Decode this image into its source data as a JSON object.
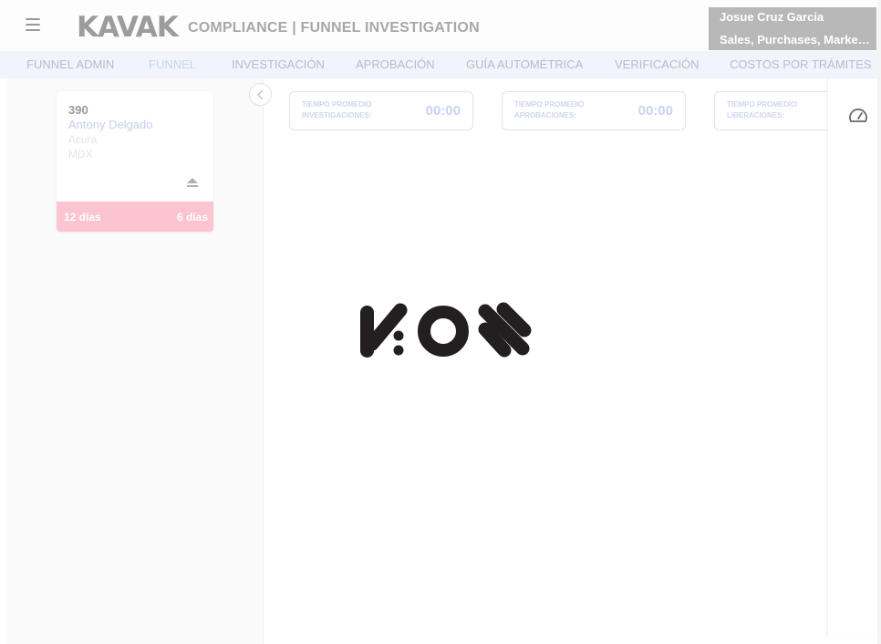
{
  "header": {
    "menu_icon": "hamburger-menu-icon",
    "logo": "KAVAK",
    "title": "COMPLIANCE | FUNNEL INVESTIGATION",
    "user": {
      "name": "Josue Cruz Garcia",
      "roles": "Sales, Purchases, Marketing"
    }
  },
  "nav": {
    "tabs": [
      {
        "label": "FUNNEL ADMIN"
      },
      {
        "label": "FUNNEL",
        "active": true
      },
      {
        "label": "INVESTIGACIÓN"
      },
      {
        "label": "APROBACIÓN"
      },
      {
        "label": "GUÍA AUTOMÉTRICA"
      },
      {
        "label": "VERIFICACIÓN"
      },
      {
        "label": "COSTOS POR TRÁMITES"
      }
    ]
  },
  "card": {
    "id": "390",
    "name": "Antony Delgado",
    "make": "Acura",
    "model": "MDX",
    "action_icon": "eject-icon",
    "days_left": "12 días",
    "days_right": "6 días"
  },
  "stats": [
    {
      "label_line1": "TIEMPO PROMEDIO",
      "label_line2": "INVESTIGACIONES:",
      "value": "00:00"
    },
    {
      "label_line1": "TIEMPO PROMEDIO",
      "label_line2": "APROBACIONES:",
      "value": "00:00"
    },
    {
      "label_line1": "TIEMPO PROMEDIO",
      "label_line2": "LIBERACIONES:",
      "value": ""
    }
  ],
  "side_panel": {
    "icon": "speedometer-icon"
  },
  "loader": {
    "logo": "KOS",
    "icon": "kos-logo-icon"
  },
  "colors": {
    "accent_light": "#c9d4f0",
    "card_footer": "#fcc4d0",
    "user_box": "#b8b8b8",
    "nav_bg": "#f1f4fa"
  }
}
